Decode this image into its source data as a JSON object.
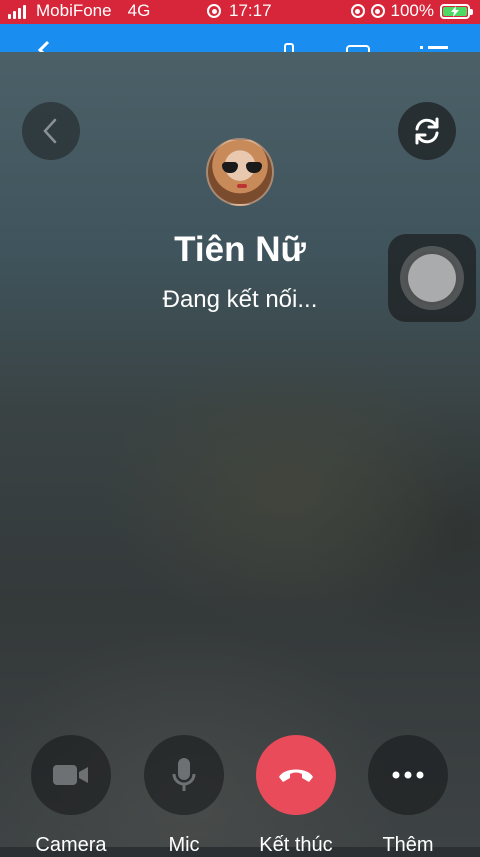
{
  "status_bar": {
    "carrier": "MobiFone",
    "network": "4G",
    "time": "17:17",
    "battery": "100%"
  },
  "call": {
    "caller_name": "Tiên Nữ",
    "status": "Đang kết nối..."
  },
  "controls": [
    {
      "label": "Camera",
      "icon": "camera-icon"
    },
    {
      "label": "Mic",
      "icon": "mic-icon"
    },
    {
      "label": "Kết thúc",
      "icon": "end-call-icon"
    },
    {
      "label": "Thêm",
      "icon": "more-icon"
    }
  ],
  "colors": {
    "status_bar": "#d7263a",
    "header": "#1a8ef0",
    "end_call": "#e94b5b"
  }
}
